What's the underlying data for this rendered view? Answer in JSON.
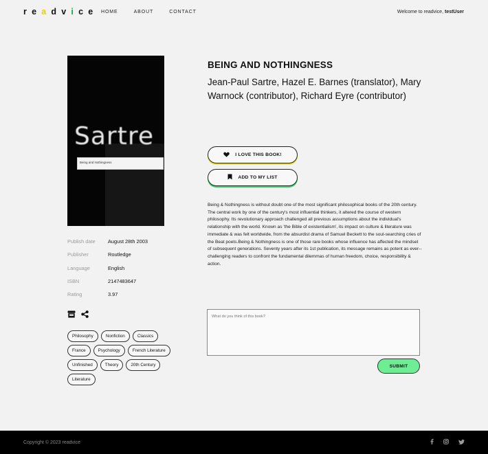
{
  "header": {
    "logo_letters": [
      "r",
      "e",
      "a",
      "d",
      "v",
      "i",
      "c",
      "e"
    ],
    "logo_colors": [
      "#111111",
      "#111111",
      "#e3d200",
      "#111111",
      "#111111",
      "#11a84a",
      "#111111",
      "#111111"
    ],
    "nav": [
      "HOME",
      "ABOUT",
      "CONTACT"
    ],
    "welcome_prefix": "Welcome to readvice,",
    "username": "testUser"
  },
  "book": {
    "cover_title": "Sartre",
    "cover_subtitle": "Being and Nothingness",
    "title": "BEING AND NOTHINGNESS",
    "authors": "Jean-Paul Sartre, Hazel E. Barnes (translator), Mary Warnock (contributor), Richard Eyre (contributor)",
    "description": "Being & Nothingness is without doubt one of the most significant philosophical books of the 20th century. The central work by one of the century's most influential thinkers, it altered the course of western philosophy. Its revolutionary approach challenged all previous assumptions about the individual's relationship with the world. Known as 'the Bible of existentialism', its impact on culture & literature was immediate & was felt worldwide, from the absurdist drama of Samuel Beckett to the soul-searching cries of the Beat poets.Being & Nothingness is one of those rare books whose influence has affected the mindset of subsequent generations. Seventy years after its 1st publication, its message remains as potent as ever--challenging readers to confront the fundamental dilemmas of human freedom, choice, responsibility & action.",
    "meta": [
      {
        "label": "Publish date",
        "value": "August 28th 2003"
      },
      {
        "label": "Publisher",
        "value": "Routledge"
      },
      {
        "label": "Language",
        "value": "English"
      },
      {
        "label": "ISBN",
        "value": "2147483647"
      },
      {
        "label": "Rating",
        "value": "3.97"
      }
    ],
    "tags": [
      [
        "Philosophy",
        "Nonfiction",
        "Classics"
      ],
      [
        "France",
        "Psychology",
        "French Literature"
      ],
      [
        "Unfinished",
        "Theory",
        "20th Century"
      ],
      [
        "Literature"
      ]
    ]
  },
  "actions": {
    "love_label": "I LOVE THIS BOOK!",
    "list_label": "ADD TO MY LIST",
    "submit_label": "SUBMIT"
  },
  "review": {
    "placeholder": "What do you think of this book?",
    "value": ""
  },
  "footer": {
    "copyright": "Copyright © 2023 readvice",
    "social_icons": [
      "facebook-icon",
      "instagram-icon",
      "twitter-icon"
    ]
  },
  "colors": {
    "accent_yellow": "#ece33c",
    "accent_green": "#3ed46a",
    "submit_green": "#6dee94"
  }
}
